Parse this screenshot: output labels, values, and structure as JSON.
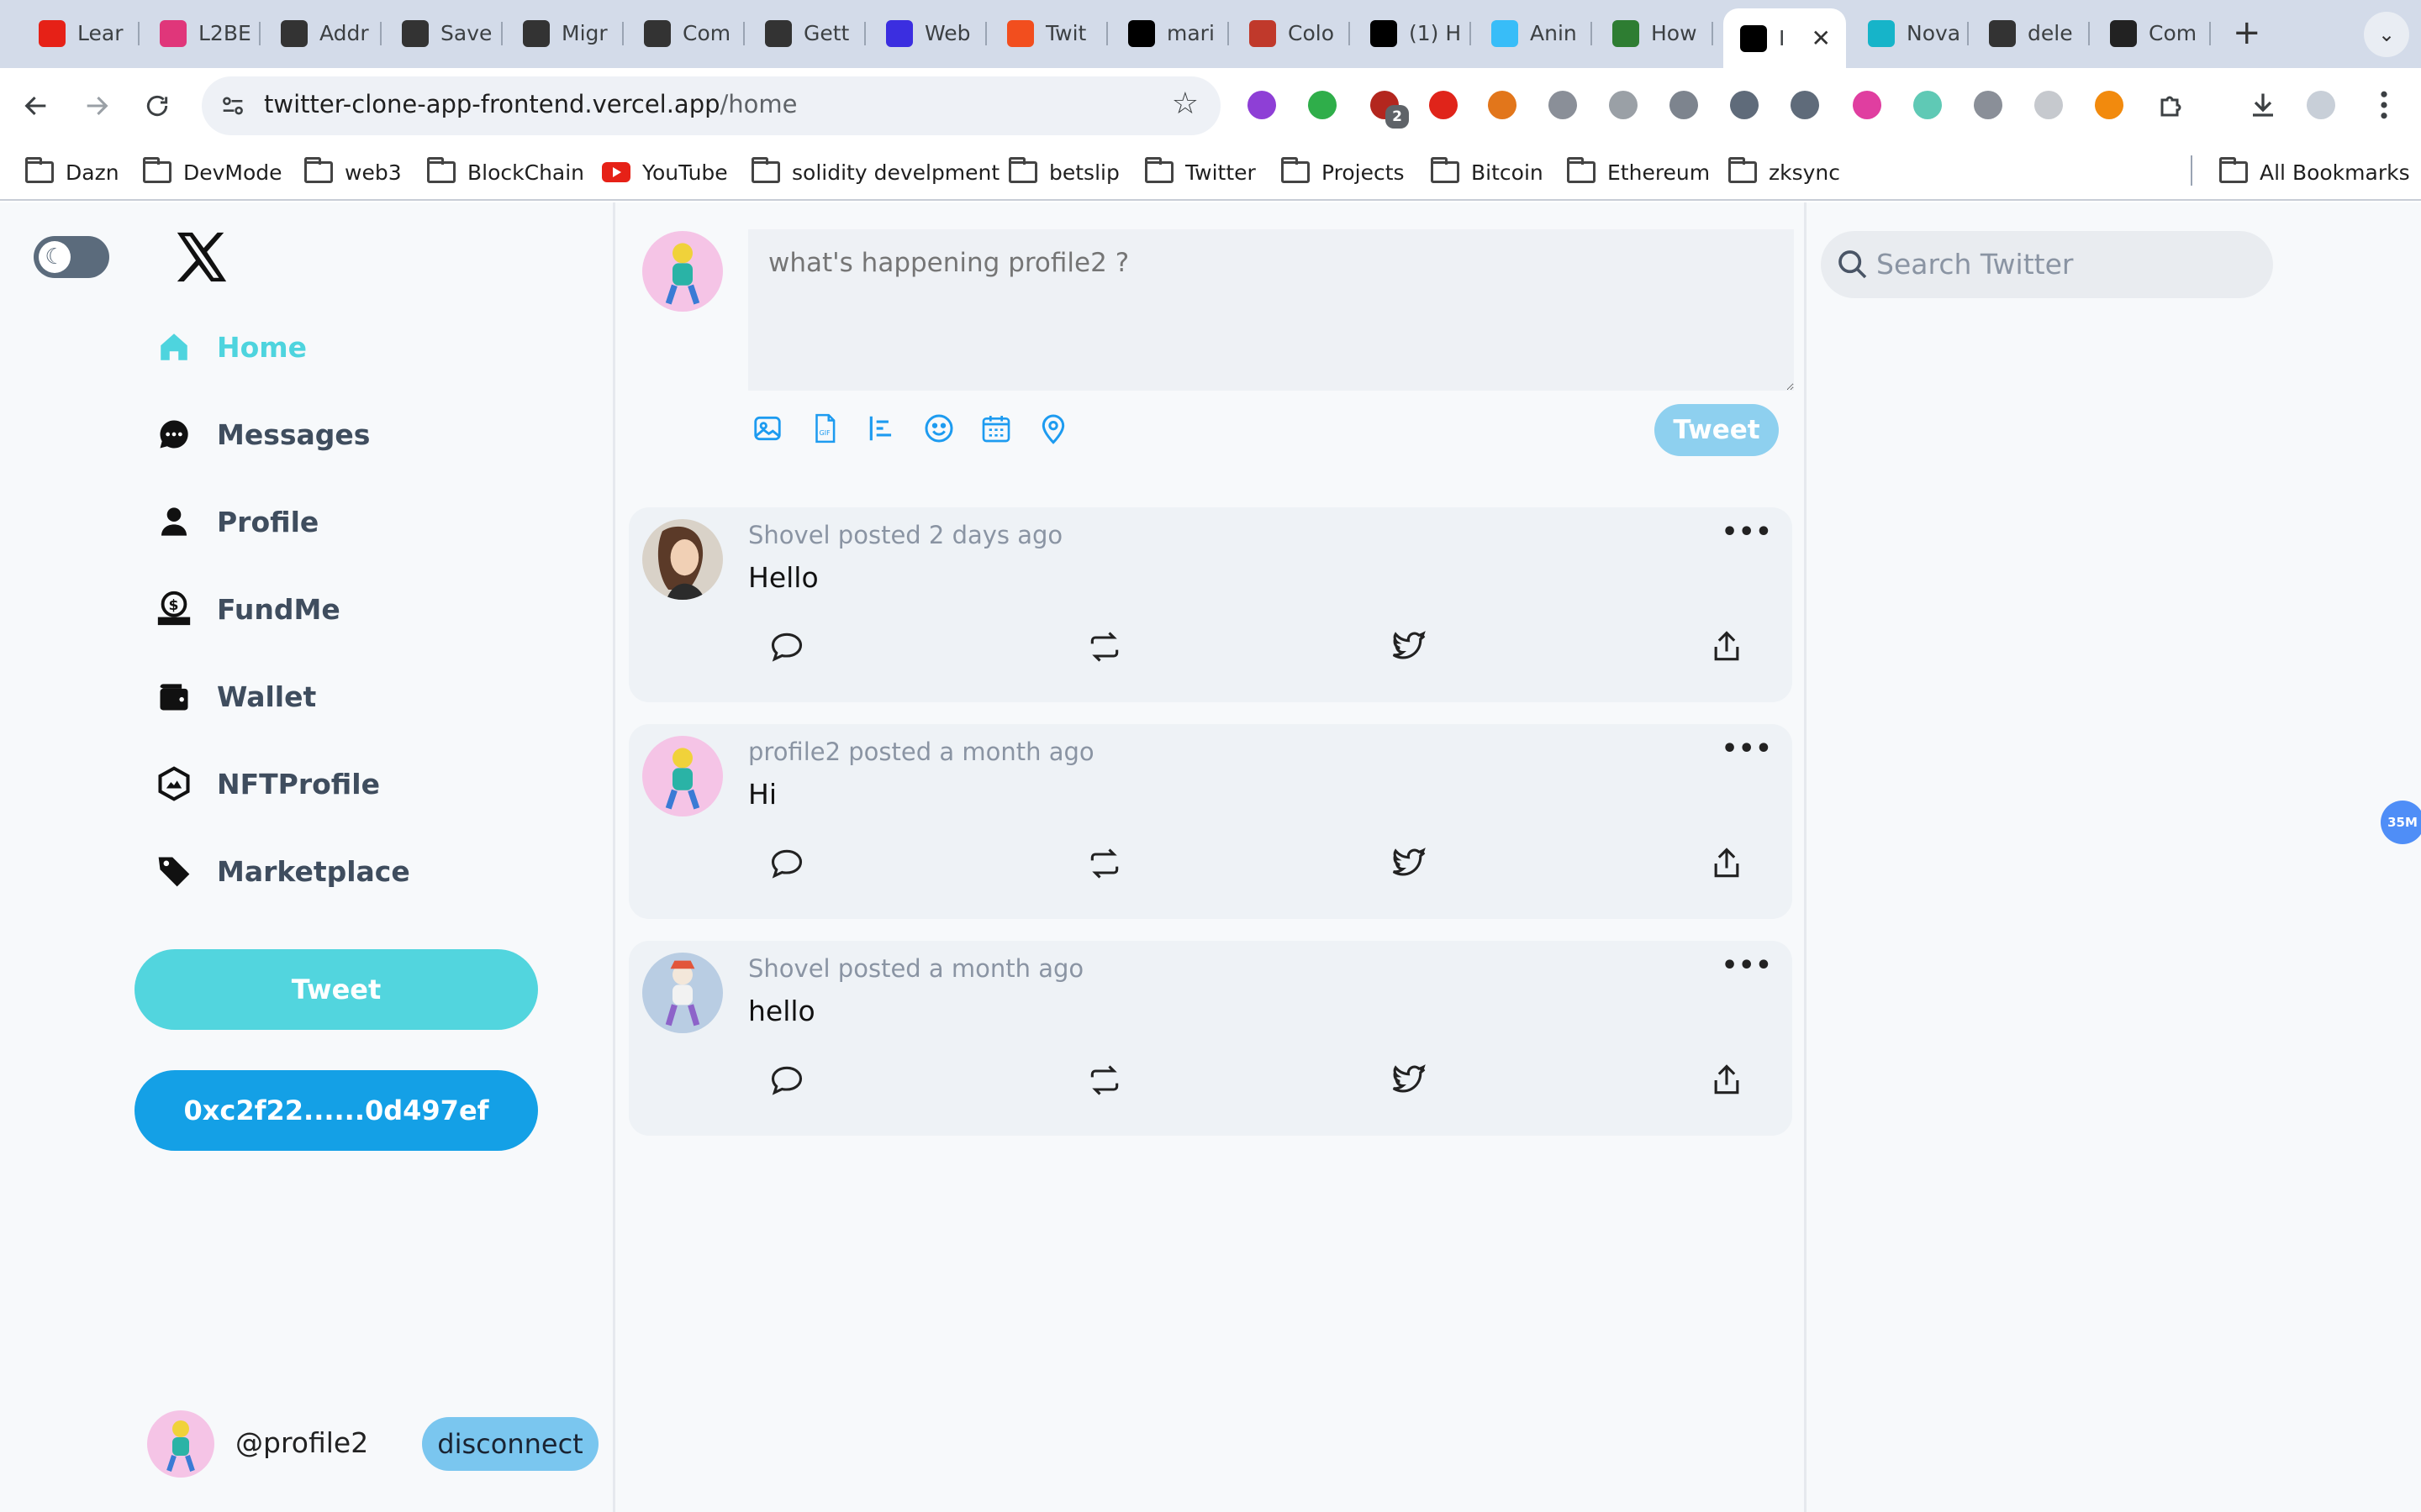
{
  "browser": {
    "tabs": [
      {
        "title": "Lear",
        "favicon": "youtube-icon",
        "color": "#e62117"
      },
      {
        "title": "L2BE",
        "favicon": "heart-icon",
        "color": "#e0367a"
      },
      {
        "title": "Addr",
        "favicon": "arrows-icon",
        "color": "#333333"
      },
      {
        "title": "Save",
        "favicon": "openai-icon",
        "color": "#333333"
      },
      {
        "title": "Migr",
        "favicon": "arrows-icon",
        "color": "#333333"
      },
      {
        "title": "Com",
        "favicon": "arrows-icon",
        "color": "#333333"
      },
      {
        "title": "Gett",
        "favicon": "arrows-icon",
        "color": "#333333"
      },
      {
        "title": "Web",
        "favicon": "web-icon",
        "color": "#3b2ee0"
      },
      {
        "title": "Twit",
        "favicon": "figma-icon",
        "color": "#f24e1e"
      },
      {
        "title": "mari",
        "favicon": "triangle-icon",
        "color": "#000000"
      },
      {
        "title": "Colo",
        "favicon": "cup-icon",
        "color": "#c0392b"
      },
      {
        "title": "(1) H",
        "favicon": "x-icon",
        "color": "#000000"
      },
      {
        "title": "Anin",
        "favicon": "tailwind-icon",
        "color": "#38bdf8"
      },
      {
        "title": "How",
        "favicon": "wm-icon",
        "color": "#2e7d32"
      },
      {
        "title": "I",
        "favicon": "triangle-icon",
        "color": "#000000"
      },
      {
        "title": "Nova",
        "favicon": "n-icon",
        "color": "#16b4c9"
      },
      {
        "title": "dele",
        "favicon": "openai-icon",
        "color": "#333333"
      },
      {
        "title": "Com",
        "favicon": "github-icon",
        "color": "#222222"
      }
    ],
    "new_tab": "+",
    "url_host": "twitter-clone-app-frontend.vercel.app",
    "url_path": "/home",
    "bookmarks": [
      {
        "label": "Dazn",
        "icon": "folder-icon"
      },
      {
        "label": "DevMode",
        "icon": "folder-icon"
      },
      {
        "label": "web3",
        "icon": "folder-icon"
      },
      {
        "label": "BlockChain",
        "icon": "folder-icon"
      },
      {
        "label": "YouTube",
        "icon": "youtube-icon"
      },
      {
        "label": "solidity develpment",
        "icon": "folder-icon"
      },
      {
        "label": "betslip",
        "icon": "folder-icon"
      },
      {
        "label": "Twitter",
        "icon": "folder-icon"
      },
      {
        "label": "Projects",
        "icon": "folder-icon"
      },
      {
        "label": "Bitcoin",
        "icon": "folder-icon"
      },
      {
        "label": "Ethereum",
        "icon": "folder-icon"
      },
      {
        "label": "zksync",
        "icon": "folder-icon"
      }
    ],
    "all_bookmarks": "All Bookmarks",
    "ext_badge": "2"
  },
  "sidebar": {
    "nav": [
      {
        "label": "Home",
        "icon": "home-icon",
        "active": true
      },
      {
        "label": "Messages",
        "icon": "chat-icon"
      },
      {
        "label": "Profile",
        "icon": "user-icon"
      },
      {
        "label": "FundMe",
        "icon": "dollar-icon"
      },
      {
        "label": "Wallet",
        "icon": "wallet-icon"
      },
      {
        "label": "NFTProfile",
        "icon": "nft-icon"
      },
      {
        "label": "Marketplace",
        "icon": "tag-icon"
      }
    ],
    "tweet_button": "Tweet",
    "address_button": "0xc2f22......0d497ef",
    "user_handle": "@profile2",
    "disconnect": "disconnect"
  },
  "composer": {
    "placeholder": "what's happening profile2 ?",
    "tools": [
      "image-icon",
      "gif-icon",
      "poll-icon",
      "emoji-icon",
      "schedule-icon",
      "location-icon"
    ],
    "tweet_button": "Tweet"
  },
  "posts": [
    {
      "meta": "Shovel posted 2 days ago",
      "text": "Hello",
      "avatar": "avatar-shovel-1"
    },
    {
      "meta": "profile2 posted a month ago",
      "text": "Hi",
      "avatar": "avatar-profile2"
    },
    {
      "meta": "Shovel posted a month ago",
      "text": "hello",
      "avatar": "avatar-shovel-2"
    }
  ],
  "post_more": "•••",
  "search": {
    "placeholder": "Search Twitter"
  },
  "floating_badge": "35M",
  "colors": {
    "accent": "#4ed4de",
    "address_button": "#14a0e6",
    "composer_tweet": "#8ed0ef",
    "disconnect": "#7ac6ef",
    "icon_blue": "#1d9bf0"
  }
}
